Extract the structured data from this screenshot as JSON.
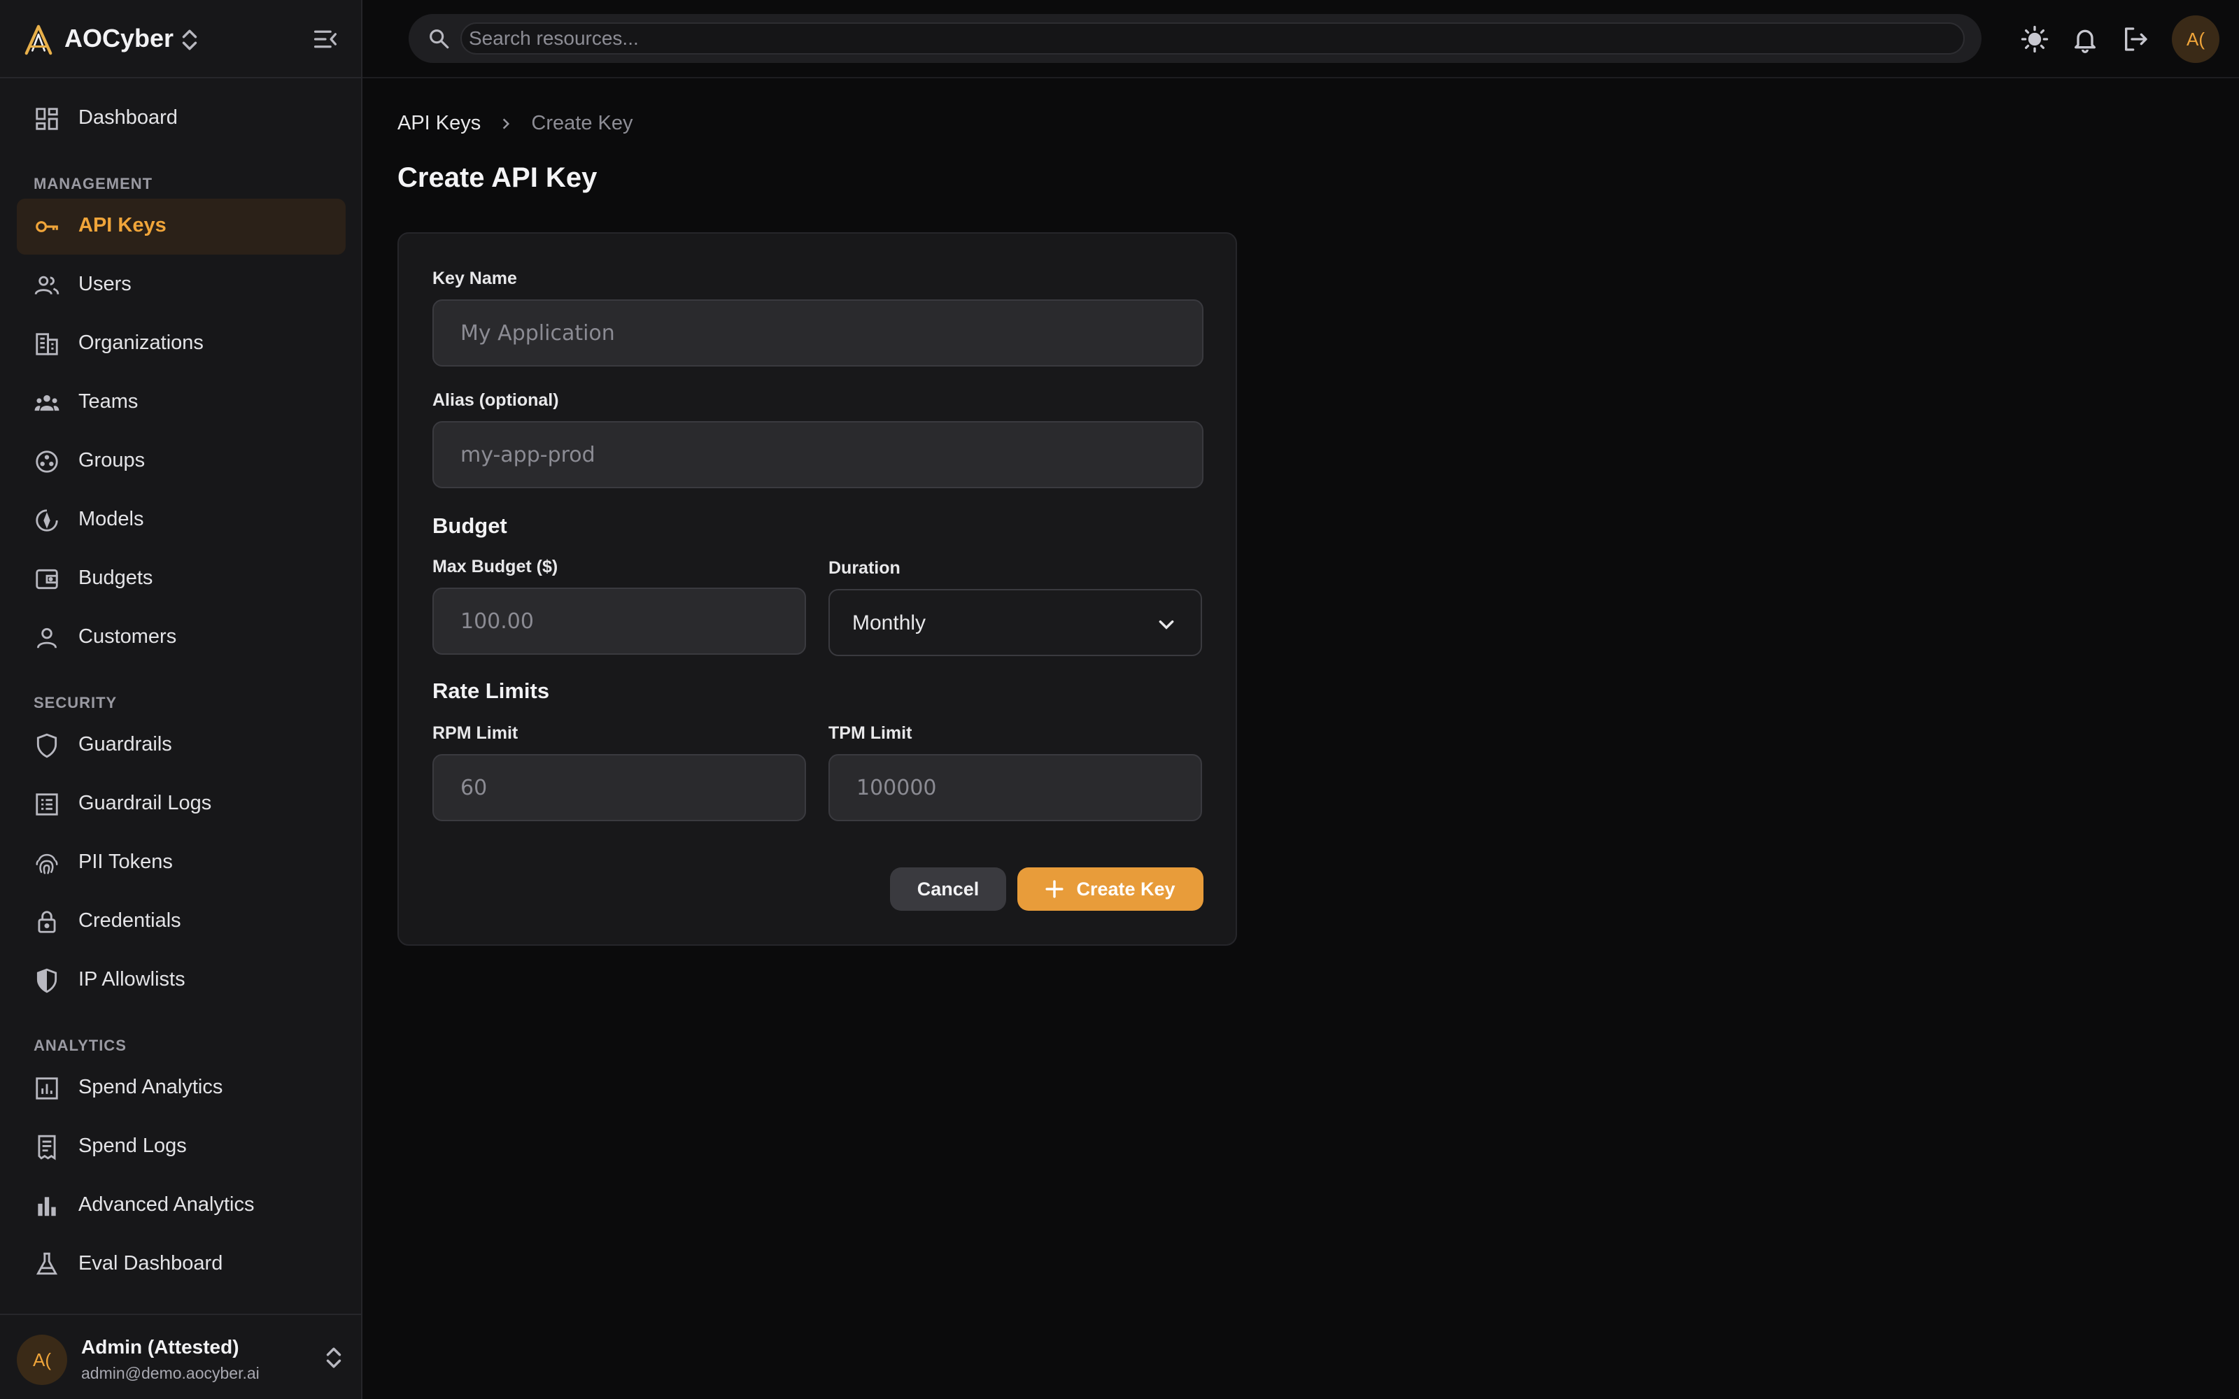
{
  "brand": {
    "name": "AOCyber"
  },
  "search": {
    "placeholder": "Search resources..."
  },
  "topbar": {
    "avatar_initials": "A("
  },
  "sidebar": {
    "items": [
      {
        "label": "Dashboard",
        "icon": "dashboard-icon"
      },
      {
        "section": "MANAGEMENT"
      },
      {
        "label": "API Keys",
        "icon": "key-icon",
        "active": true
      },
      {
        "label": "Users",
        "icon": "users-icon"
      },
      {
        "label": "Organizations",
        "icon": "building-icon"
      },
      {
        "label": "Teams",
        "icon": "teams-icon"
      },
      {
        "label": "Groups",
        "icon": "groups-icon"
      },
      {
        "label": "Models",
        "icon": "models-icon"
      },
      {
        "label": "Budgets",
        "icon": "wallet-icon"
      },
      {
        "label": "Customers",
        "icon": "person-icon"
      },
      {
        "section": "SECURITY"
      },
      {
        "label": "Guardrails",
        "icon": "shield-icon"
      },
      {
        "label": "Guardrail Logs",
        "icon": "log-list-icon"
      },
      {
        "label": "PII Tokens",
        "icon": "fingerprint-icon"
      },
      {
        "label": "Credentials",
        "icon": "lock-icon"
      },
      {
        "label": "IP Allowlists",
        "icon": "shield-half-icon"
      },
      {
        "section": "ANALYTICS"
      },
      {
        "label": "Spend Analytics",
        "icon": "analytics-icon"
      },
      {
        "label": "Spend Logs",
        "icon": "receipt-icon"
      },
      {
        "label": "Advanced Analytics",
        "icon": "bar-chart-icon"
      },
      {
        "label": "Eval Dashboard",
        "icon": "flask-icon"
      }
    ]
  },
  "user": {
    "initials": "A(",
    "name": "Admin (Attested)",
    "email": "admin@demo.aocyber.ai"
  },
  "breadcrumb": {
    "parent": "API Keys",
    "current": "Create Key"
  },
  "page": {
    "title": "Create API Key"
  },
  "form": {
    "key_name": {
      "label": "Key Name",
      "placeholder": "My Application"
    },
    "alias": {
      "label": "Alias (optional)",
      "placeholder": "my-app-prod"
    },
    "budget_heading": "Budget",
    "max_budget": {
      "label": "Max Budget ($)",
      "placeholder": "100.00"
    },
    "duration": {
      "label": "Duration",
      "value": "Monthly"
    },
    "rate_heading": "Rate Limits",
    "rpm": {
      "label": "RPM Limit",
      "placeholder": "60"
    },
    "tpm": {
      "label": "TPM Limit",
      "placeholder": "100000"
    },
    "cancel_label": "Cancel",
    "create_label": "Create Key"
  },
  "colors": {
    "accent": "#e89c3a",
    "background": "#0b0b0c",
    "sidebar": "#171719"
  }
}
